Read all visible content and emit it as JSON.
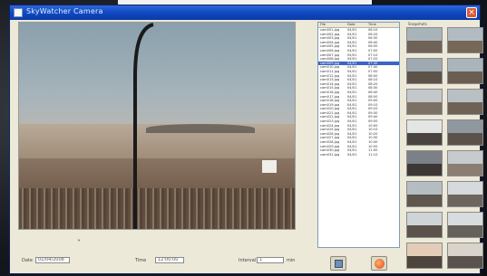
{
  "window": {
    "title": "SkyWatcher Camera",
    "close_label": "×"
  },
  "controls": {
    "left_label": "Date",
    "left_value": "01/04/2008",
    "mid_label": "Time",
    "mid_value": "12:00:00",
    "right_label": "Interval",
    "right_value": "1",
    "right_unit": "min"
  },
  "recordings": {
    "headers": [
      "File",
      "Date",
      "Time"
    ],
    "selected_index": 8,
    "rows": [
      [
        "cam001.jpg",
        "04/01",
        "06:10"
      ],
      [
        "cam002.jpg",
        "04/01",
        "06:20"
      ],
      [
        "cam003.jpg",
        "04/01",
        "06:30"
      ],
      [
        "cam004.jpg",
        "04/01",
        "06:40"
      ],
      [
        "cam005.jpg",
        "04/01",
        "06:50"
      ],
      [
        "cam006.jpg",
        "04/01",
        "07:00"
      ],
      [
        "cam007.jpg",
        "04/01",
        "07:10"
      ],
      [
        "cam008.jpg",
        "04/01",
        "07:20"
      ],
      [
        "cam009.jpg",
        "04/01",
        "07:30"
      ],
      [
        "cam010.jpg",
        "04/01",
        "07:40"
      ],
      [
        "cam011.jpg",
        "04/01",
        "07:50"
      ],
      [
        "cam012.jpg",
        "04/01",
        "08:00"
      ],
      [
        "cam013.jpg",
        "04/01",
        "08:10"
      ],
      [
        "cam014.jpg",
        "04/01",
        "08:20"
      ],
      [
        "cam015.jpg",
        "04/01",
        "08:30"
      ],
      [
        "cam016.jpg",
        "04/01",
        "08:40"
      ],
      [
        "cam017.jpg",
        "04/01",
        "08:50"
      ],
      [
        "cam018.jpg",
        "04/01",
        "09:00"
      ],
      [
        "cam019.jpg",
        "04/01",
        "09:10"
      ],
      [
        "cam020.jpg",
        "04/01",
        "09:20"
      ],
      [
        "cam021.jpg",
        "04/01",
        "09:30"
      ],
      [
        "cam022.jpg",
        "04/01",
        "09:40"
      ],
      [
        "cam023.jpg",
        "04/01",
        "09:50"
      ],
      [
        "cam024.jpg",
        "04/01",
        "10:00"
      ],
      [
        "cam025.jpg",
        "04/01",
        "10:10"
      ],
      [
        "cam026.jpg",
        "04/01",
        "10:20"
      ],
      [
        "cam027.jpg",
        "04/01",
        "10:30"
      ],
      [
        "cam028.jpg",
        "04/01",
        "10:40"
      ],
      [
        "cam029.jpg",
        "04/01",
        "10:50"
      ],
      [
        "cam030.jpg",
        "04/01",
        "11:00"
      ],
      [
        "cam031.jpg",
        "04/01",
        "11:10"
      ]
    ]
  },
  "thumbnails": {
    "label": "Snapshots",
    "items": [
      {
        "sky": "#a9b3ba",
        "ground": "#6f6357"
      },
      {
        "sky": "#b2bbc1",
        "ground": "#756859"
      },
      {
        "sky": "#9ea9b1",
        "ground": "#5d5349"
      },
      {
        "sky": "#aab4bb",
        "ground": "#6a5e52"
      },
      {
        "sky": "#c4c8cb",
        "ground": "#7d7165"
      },
      {
        "sky": "#b9c0c4",
        "ground": "#6e6257"
      },
      {
        "sky": "#e4e6e6",
        "ground": "#4a4440"
      },
      {
        "sky": "#8f989f",
        "ground": "#5a524b"
      },
      {
        "sky": "#7b8187",
        "ground": "#3d3835"
      },
      {
        "sky": "#c7cbcd",
        "ground": "#8a7e72"
      },
      {
        "sky": "#b5bdc2",
        "ground": "#5f564d"
      },
      {
        "sky": "#d6dadc",
        "ground": "#6d665f"
      },
      {
        "sky": "#cfd4d7",
        "ground": "#5b524a"
      },
      {
        "sky": "#d9dcde",
        "ground": "#66605a"
      },
      {
        "sky": "#e3cdb8",
        "ground": "#4d443d"
      },
      {
        "sky": "#d9d3cb",
        "ground": "#5a524c"
      }
    ]
  }
}
